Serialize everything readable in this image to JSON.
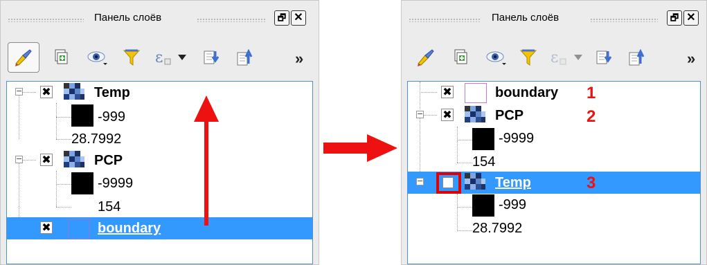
{
  "panel_title": "Панель слоёв",
  "before": {
    "layers": [
      {
        "name": "Temp",
        "checked": "✖",
        "expander": "−",
        "legend": [
          "-999",
          "28.7992"
        ]
      },
      {
        "name": "PCP",
        "checked": "✖",
        "expander": "−",
        "legend": [
          "-9999",
          "154"
        ]
      },
      {
        "name": "boundary",
        "checked": "✖",
        "selected": true
      }
    ]
  },
  "after": {
    "layers": [
      {
        "name": "boundary",
        "checked": "✖",
        "annotation": "1"
      },
      {
        "name": "PCP",
        "checked": "✖",
        "expander": "−",
        "legend": [
          "-9999",
          "154"
        ],
        "annotation": "2"
      },
      {
        "name": "Temp",
        "checked": "",
        "expander": "−",
        "legend": [
          "-999",
          "28.7992"
        ],
        "annotation": "3",
        "selected": true
      }
    ]
  },
  "toolbar": {
    "overflow": "»",
    "icons": [
      "style-brush-icon",
      "add-group-icon",
      "visibility-eye-icon",
      "filter-funnel-icon",
      "expression-filter-icon",
      "expand-all-icon",
      "collapse-all-icon"
    ]
  },
  "window_buttons": {
    "float": "🗗",
    "close": "✕"
  },
  "colors": {
    "selection": "#3399ff",
    "tree_border": "#4a8fd8",
    "annotation_red": "#ee1111",
    "boundary_outline": "#c27bd0"
  }
}
